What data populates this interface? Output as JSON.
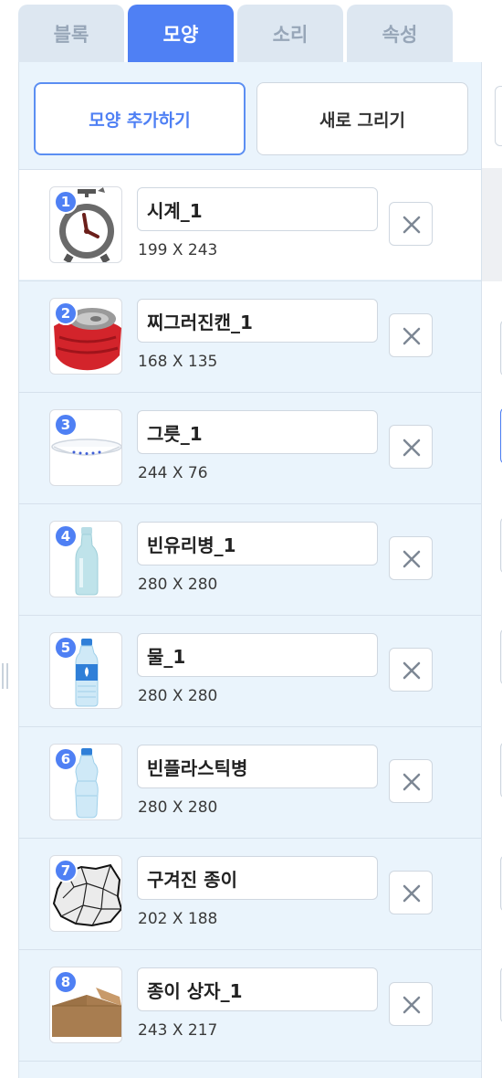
{
  "tabs": [
    {
      "label": "블록"
    },
    {
      "label": "모양"
    },
    {
      "label": "소리"
    },
    {
      "label": "속성"
    }
  ],
  "active_tab": "모양",
  "buttons": {
    "add_label": "모양 추가하기",
    "draw_label": "새로 그리기"
  },
  "costumes": [
    {
      "number": "1",
      "name": "시계_1",
      "size": "199 X 243",
      "icon": "alarm-clock-icon"
    },
    {
      "number": "2",
      "name": "찌그러진캔_1",
      "size": "168 X 135",
      "icon": "crushed-can-icon"
    },
    {
      "number": "3",
      "name": "그릇_1",
      "size": "244 X 76",
      "icon": "bowl-icon"
    },
    {
      "number": "4",
      "name": "빈유리병_1",
      "size": "280 X 280",
      "icon": "glass-bottle-icon"
    },
    {
      "number": "5",
      "name": "물_1",
      "size": "280 X 280",
      "icon": "water-bottle-icon"
    },
    {
      "number": "6",
      "name": "빈플라스틱병",
      "size": "280 X 280",
      "icon": "plastic-bottle-icon"
    },
    {
      "number": "7",
      "name": "구겨진 종이",
      "size": "202 X 188",
      "icon": "crumpled-paper-icon"
    },
    {
      "number": "8",
      "name": "종이 상자_1",
      "size": "243 X 217",
      "icon": "cardboard-box-icon"
    }
  ],
  "colors": {
    "accent": "#4f80f4",
    "panel_bg": "#eaf4fc",
    "selected_bg": "#ffffff"
  }
}
